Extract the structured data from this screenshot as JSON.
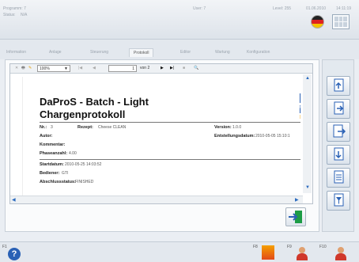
{
  "header": {
    "programm_label": "Programm: 7",
    "status_label": "Status:",
    "status_value": "N/A",
    "user_label": "User: 7",
    "level_label": "Level: 255",
    "date": "01.06.2010",
    "time": "14:11:19"
  },
  "tabs": [
    "Information",
    "Anlage",
    "Steuerung",
    "Protokoll",
    "Editor",
    "Wartung",
    "Konfiguration"
  ],
  "active_tab": "Protokoll",
  "viewer_toolbar": {
    "zoom": "100%",
    "page": "1",
    "page_of": "von 2"
  },
  "report": {
    "title_line1": "DaProS - Batch - Light",
    "title_line2": "Chargenprotokoll",
    "nr_label": "Nr.:",
    "nr_value": "3",
    "rezept_label": "Rezept:",
    "rezept_value": "Cheese CLEAN",
    "version_label": "Version:",
    "version_value": "1.0.0",
    "autor_label": "Autor:",
    "erstellung_label": "Entstellungsdatum:",
    "erstellung_value": "2010-05-05 15:10:1",
    "kommentar_label": "Kommentar:",
    "phasen_label": "Phaseanzahl:",
    "phasen_value": "4.00",
    "start_label": "Startdatum:",
    "start_value": "2010-05-25 14:03:52",
    "bediener_label": "Bediener:",
    "bediener_value": "GTI",
    "abschluss_label": "Abschlussstatus:",
    "abschluss_value": "FINISHED"
  },
  "footer": {
    "f1": "F1",
    "f8": "F8",
    "f9": "F9",
    "f10": "F10"
  },
  "colors": {
    "accent_blue": "#2a61b5",
    "orange": "#f5a000",
    "green": "#1c9c45"
  }
}
